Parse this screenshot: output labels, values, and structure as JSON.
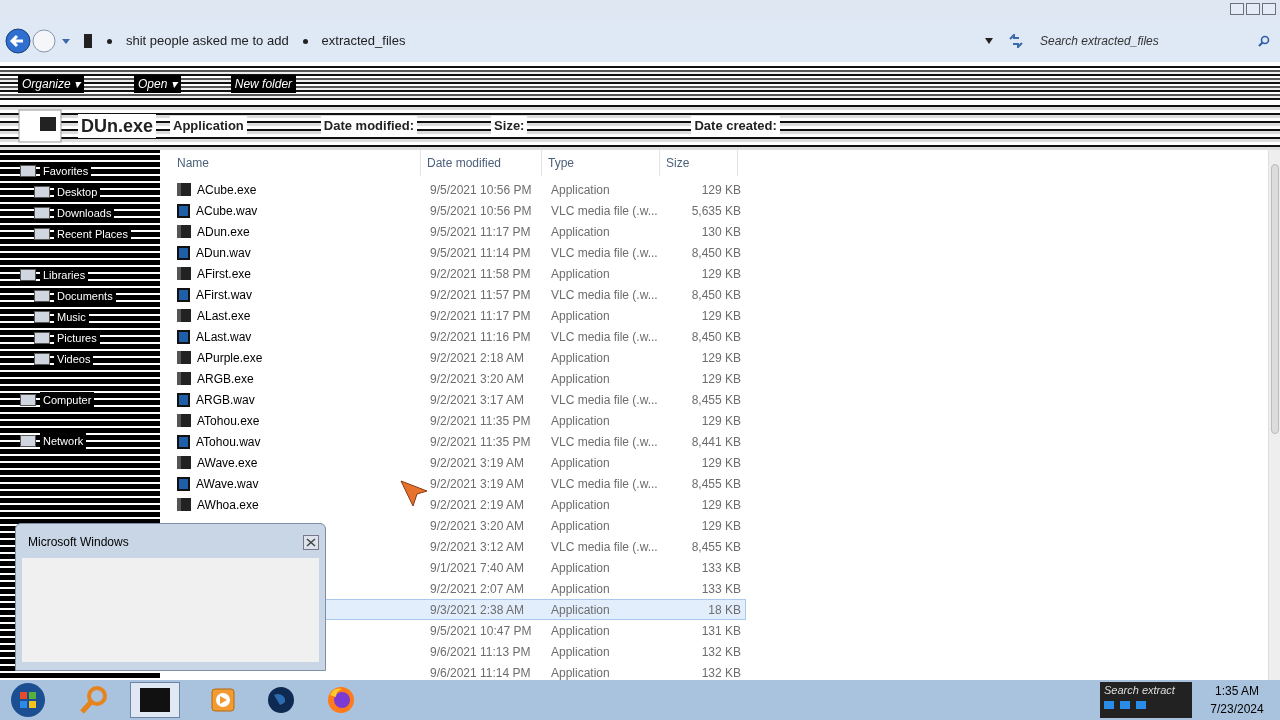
{
  "address_bar": {
    "path": [
      "shit people asked me to add",
      "extracted_files"
    ],
    "search": {
      "placeholder": "Search extracted_files"
    }
  },
  "toolbar": {
    "items": [
      "Organize ▾",
      "Open ▾",
      "New folder"
    ]
  },
  "details_pane": {
    "name": "DUn.exe",
    "type": "Application",
    "fields": [
      "Date modified:",
      "Size:",
      "Date created:"
    ]
  },
  "sidebar": {
    "items": [
      {
        "label": "Favorites",
        "children": [
          {
            "label": "Desktop"
          },
          {
            "label": "Downloads"
          },
          {
            "label": "Recent Places"
          }
        ]
      },
      {
        "label": "Libraries",
        "children": [
          {
            "label": "Documents"
          },
          {
            "label": "Music"
          },
          {
            "label": "Pictures"
          },
          {
            "label": "Videos"
          }
        ]
      },
      {
        "label": "Computer"
      },
      {
        "label": "Network"
      }
    ]
  },
  "table": {
    "columns": [
      "Name",
      "Date modified",
      "Type",
      "Size"
    ],
    "rows": [
      {
        "name": "ACube.exe",
        "kind": "exe",
        "date": "9/5/2021 10:56 PM",
        "type": "Application",
        "size": "129 KB",
        "selected": false
      },
      {
        "name": "ACube.wav",
        "kind": "wav",
        "date": "9/5/2021 10:56 PM",
        "type": "VLC media file (.w...",
        "size": "5,635 KB",
        "selected": false
      },
      {
        "name": "ADun.exe",
        "kind": "exe",
        "date": "9/5/2021 11:17 PM",
        "type": "Application",
        "size": "130 KB",
        "selected": false
      },
      {
        "name": "ADun.wav",
        "kind": "wav",
        "date": "9/5/2021 11:14 PM",
        "type": "VLC media file (.w...",
        "size": "8,450 KB",
        "selected": false
      },
      {
        "name": "AFirst.exe",
        "kind": "exe",
        "date": "9/2/2021 11:58 PM",
        "type": "Application",
        "size": "129 KB",
        "selected": false
      },
      {
        "name": "AFirst.wav",
        "kind": "wav",
        "date": "9/2/2021 11:57 PM",
        "type": "VLC media file (.w...",
        "size": "8,450 KB",
        "selected": false
      },
      {
        "name": "ALast.exe",
        "kind": "exe",
        "date": "9/2/2021 11:17 PM",
        "type": "Application",
        "size": "129 KB",
        "selected": false
      },
      {
        "name": "ALast.wav",
        "kind": "wav",
        "date": "9/2/2021 11:16 PM",
        "type": "VLC media file (.w...",
        "size": "8,450 KB",
        "selected": false
      },
      {
        "name": "APurple.exe",
        "kind": "exe",
        "date": "9/2/2021 2:18 AM",
        "type": "Application",
        "size": "129 KB",
        "selected": false
      },
      {
        "name": "ARGB.exe",
        "kind": "exe",
        "date": "9/2/2021 3:20 AM",
        "type": "Application",
        "size": "129 KB",
        "selected": false
      },
      {
        "name": "ARGB.wav",
        "kind": "wav",
        "date": "9/2/2021 3:17 AM",
        "type": "VLC media file (.w...",
        "size": "8,455 KB",
        "selected": false
      },
      {
        "name": "ATohou.exe",
        "kind": "exe",
        "date": "9/2/2021 11:35 PM",
        "type": "Application",
        "size": "129 KB",
        "selected": false
      },
      {
        "name": "ATohou.wav",
        "kind": "wav",
        "date": "9/2/2021 11:35 PM",
        "type": "VLC media file (.w...",
        "size": "8,441 KB",
        "selected": false
      },
      {
        "name": "AWave.exe",
        "kind": "exe",
        "date": "9/2/2021 3:19 AM",
        "type": "Application",
        "size": "129 KB",
        "selected": false
      },
      {
        "name": "AWave.wav",
        "kind": "wav",
        "date": "9/2/2021 3:19 AM",
        "type": "VLC media file (.w...",
        "size": "8,455 KB",
        "selected": false
      },
      {
        "name": "AWhoa.exe",
        "kind": "exe",
        "date": "9/2/2021 2:19 AM",
        "type": "Application",
        "size": "129 KB",
        "selected": false
      },
      {
        "date": "9/2/2021 3:20 AM",
        "type": "Application",
        "size": "129 KB",
        "selected": false
      },
      {
        "date": "9/2/2021 3:12 AM",
        "type": "VLC media file (.w...",
        "size": "8,455 KB",
        "selected": false
      },
      {
        "date": "9/1/2021 7:40 AM",
        "type": "Application",
        "size": "133 KB",
        "selected": false
      },
      {
        "date": "9/2/2021 2:07 AM",
        "type": "Application",
        "size": "133 KB",
        "selected": false
      },
      {
        "date": "9/3/2021 2:38 AM",
        "type": "Application",
        "size": "18 KB",
        "selected": true
      },
      {
        "date": "9/5/2021 10:47 PM",
        "type": "Application",
        "size": "131 KB",
        "selected": false
      },
      {
        "date": "9/6/2021 11:13 PM",
        "type": "Application",
        "size": "132 KB",
        "selected": false
      },
      {
        "date": "9/6/2021 11:14 PM",
        "type": "Application",
        "size": "132 KB",
        "selected": false
      }
    ]
  },
  "dialog": {
    "title": "Microsoft Windows"
  },
  "taskbar": {
    "tray_text": "Search extract",
    "time": "1:35 AM",
    "date": "7/23/2024"
  }
}
